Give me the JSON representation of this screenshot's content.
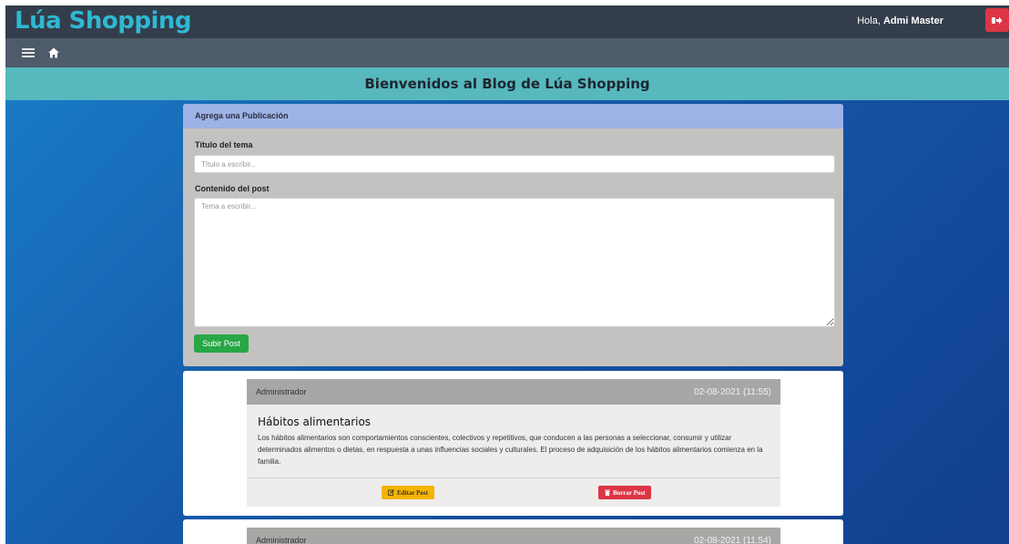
{
  "header": {
    "brand": "Lúa Shopping",
    "greeting_prefix": "Hola,",
    "user_name": "Admi Master",
    "logout_icon": "sign-out-icon"
  },
  "subnav": {
    "menu_icon": "hamburger-icon",
    "home_icon": "home-icon"
  },
  "banner": {
    "title": "Bienvenidos al Blog de Lúa Shopping"
  },
  "form": {
    "header": "Agrega una Publicación",
    "title_label": "Título del tema",
    "title_placeholder": "Título a escribir...",
    "title_value": "",
    "content_label": "Contenido del post",
    "content_placeholder": "Tema a escribir...",
    "content_value": "",
    "submit_label": "Subir Post"
  },
  "posts": [
    {
      "author": "Administrador",
      "date": "02-08-2021 (11:55)",
      "title": "Hábitos alimentarios",
      "body": "Los hábitos alimentarios son comportamientos conscientes, colectivos y repetitivos, que conducen a las personas a seleccionar, consumir y utilizar determinados alimentos o dietas, en respuesta a unas influencias sociales y culturales. El proceso de adquisición de los hábitos alimentarios comienza en la familia.",
      "edit_label": "Editar Post",
      "delete_label": "Borrar Post"
    },
    {
      "author": "Administrador",
      "date": "02-08-2021 (11:54)"
    }
  ],
  "colors": {
    "brand": "#2fb8d2",
    "topbar": "#343d4b",
    "banner": "#57b8bd",
    "form_header": "#9db2e6",
    "submit": "#28a745",
    "edit": "#f4b400",
    "delete": "#dc3545"
  }
}
